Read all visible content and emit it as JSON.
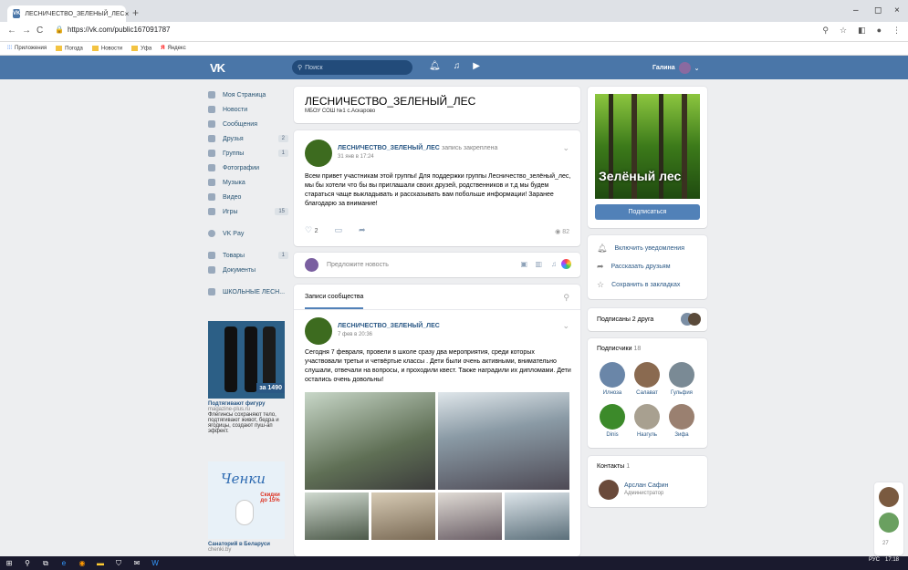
{
  "browser": {
    "tab_title": "ЛЕСНИЧЕСТВО_ЗЕЛЕНЫЙ_ЛЕС",
    "tab_close": "×",
    "new_tab": "+",
    "url": "https://vk.com/public167091787",
    "min": "–",
    "max": "◻",
    "close": "×",
    "back": "←",
    "forward": "→",
    "reload": "C"
  },
  "bookmarks": {
    "apps": "Приложения",
    "items": [
      "Погода",
      "Новости",
      "Уфа"
    ],
    "yandex": "Яндекс"
  },
  "header": {
    "logo": "VK",
    "search_placeholder": "Поиск",
    "user": "Галина"
  },
  "nav": {
    "items": [
      {
        "label": "Моя Страница"
      },
      {
        "label": "Новости"
      },
      {
        "label": "Сообщения"
      },
      {
        "label": "Друзья",
        "count": "2"
      },
      {
        "label": "Группы",
        "count": "1"
      },
      {
        "label": "Фотографии"
      },
      {
        "label": "Музыка"
      },
      {
        "label": "Видео"
      },
      {
        "label": "Игры",
        "count": "15"
      }
    ],
    "vkpay": "VK Pay",
    "goods": "Товары",
    "goods_count": "1",
    "docs": "Документы",
    "group": "ШКОЛЬНЫЕ ЛЕСН..."
  },
  "ads": [
    {
      "title": "Подтягивают фигуру",
      "site": "magazine-plus.ru",
      "text": "Флегинсы сохраняют тело, подтягивают живот, бедра и ягодицы, создают пуш-ап эффект.",
      "badge": "за 1490"
    },
    {
      "title": "Санаторий в Беларуси",
      "site": "chenki.by",
      "brand": "Ченки",
      "sale": "Скидки до 15%"
    }
  ],
  "group": {
    "name": "ЛЕСНИЧЕСТВО_ЗЕЛЕНЫЙ_ЛЕС",
    "school": "МБОУ СОШ №1 с.Аскарово"
  },
  "pinned": {
    "author": "ЛЕСНИЧЕСТВО_ЗЕЛЕНЫЙ_ЛЕС",
    "pin": "запись закреплена",
    "date": "31 янв в 17:24",
    "text": "Всем привет участникам этой группы! Для поддержки группы Лесничество_зелёный_лес, мы бы хотели что бы вы приглашали своих друзей, родственников и т.д мы будем стараться чаще выкладывать и рассказывать вам побольше информации! Заранее благодарю за внимание!",
    "likes": "2",
    "views": "82"
  },
  "suggest": "Предложите новость",
  "wall_tab": "Записи сообщества",
  "post2": {
    "author": "ЛЕСНИЧЕСТВО_ЗЕЛЕНЫЙ_ЛЕС",
    "date": "7 фев в 20:36",
    "text": "Сегодня 7 февраля, провели в школе сразу два мероприятия, среди которых участвовали третьи и четвёртые классы . Дети были очень активными, внимательно слушали, отвечали на вопросы, и проходили квест. Также наградили их дипломами. Дети остались очень довольны!"
  },
  "cover_text": "Зелёный лес",
  "subscribe": "Подписаться",
  "actions": [
    "Включить уведомления",
    "Рассказать друзьям",
    "Сохранить в закладках"
  ],
  "friends_sub": "Подписаны 2 друга",
  "subs_label": "Подписчики",
  "subs_count": "18",
  "subs": [
    "Илноза",
    "Салават",
    "Гульфия",
    "Dinis",
    "Назгуль",
    "Зифа"
  ],
  "contacts_label": "Контакты",
  "contacts_count": "1",
  "contact": {
    "name": "Арслан Сафин",
    "role": "Администратор"
  },
  "online_count": "27",
  "clock": {
    "time": "17:18",
    "lang": "РУС"
  }
}
